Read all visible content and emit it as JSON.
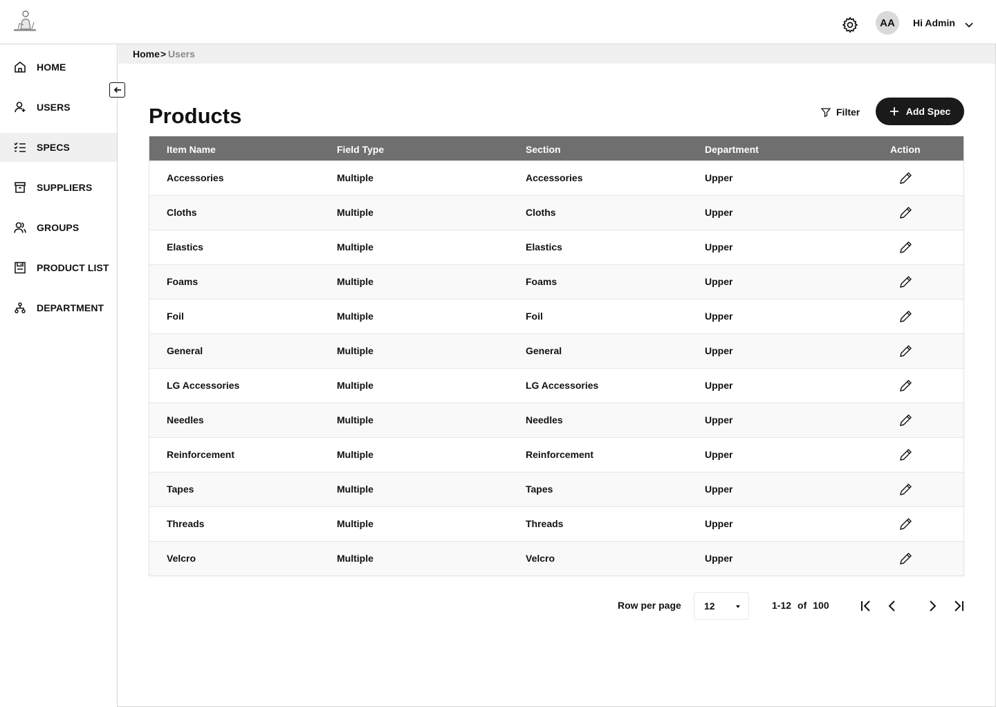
{
  "header": {
    "logo_icon": "person-sewing-logo",
    "settings_icon": "gear-icon",
    "avatar_initials": "AA",
    "greeting": "Hi Admin",
    "dropdown_icon": "chevron-down-icon"
  },
  "sidebar": {
    "items": [
      {
        "label": "HOME",
        "icon": "home-icon",
        "active": false
      },
      {
        "label": "USERS",
        "icon": "user-icon",
        "active": false
      },
      {
        "label": "SPECS",
        "icon": "checklist-icon",
        "active": true
      },
      {
        "label": "SUPPLIERS",
        "icon": "archive-box-icon",
        "active": false
      },
      {
        "label": "GROUPS",
        "icon": "group-icon",
        "active": false
      },
      {
        "label": "PRODUCT LIST",
        "icon": "floppy-disk-icon",
        "active": false
      },
      {
        "label": "DEPARTMENT",
        "icon": "hierarchy-icon",
        "active": false
      }
    ],
    "collapse_icon": "arrow-left-icon"
  },
  "breadcrumb": {
    "home": "Home",
    "separator": ">",
    "current": "Users"
  },
  "page": {
    "title": "Products",
    "filter_label": "Filter",
    "add_label": "Add Spec"
  },
  "table": {
    "columns": [
      "Item Name",
      "Field Type",
      "Section",
      "Department",
      "Action"
    ],
    "rows": [
      {
        "item": "Accessories",
        "field_type": "Multiple",
        "section": "Accessories",
        "department": "Upper"
      },
      {
        "item": "Cloths",
        "field_type": "Multiple",
        "section": "Cloths",
        "department": "Upper"
      },
      {
        "item": "Elastics",
        "field_type": "Multiple",
        "section": "Elastics",
        "department": "Upper"
      },
      {
        "item": "Foams",
        "field_type": "Multiple",
        "section": "Foams",
        "department": "Upper"
      },
      {
        "item": "Foil",
        "field_type": "Multiple",
        "section": "Foil",
        "department": "Upper"
      },
      {
        "item": "General",
        "field_type": "Multiple",
        "section": "General",
        "department": "Upper"
      },
      {
        "item": "LG Accessories",
        "field_type": "Multiple",
        "section": "LG Accessories",
        "department": "Upper"
      },
      {
        "item": "Needles",
        "field_type": "Multiple",
        "section": "Needles",
        "department": "Upper"
      },
      {
        "item": "Reinforcement",
        "field_type": "Multiple",
        "section": "Reinforcement",
        "department": "Upper"
      },
      {
        "item": "Tapes",
        "field_type": "Multiple",
        "section": "Tapes",
        "department": "Upper"
      },
      {
        "item": "Threads",
        "field_type": "Multiple",
        "section": "Threads",
        "department": "Upper"
      },
      {
        "item": "Velcro",
        "field_type": "Multiple",
        "section": "Velcro",
        "department": "Upper"
      }
    ]
  },
  "pagination": {
    "rows_label": "Row per page",
    "rows_value": "12",
    "range": "1-12",
    "of": "of",
    "total": "100"
  },
  "colors": {
    "header_row": "#6f6f6f",
    "primary_button": "#1a1a1a",
    "active_nav": "#f0f0f0"
  }
}
